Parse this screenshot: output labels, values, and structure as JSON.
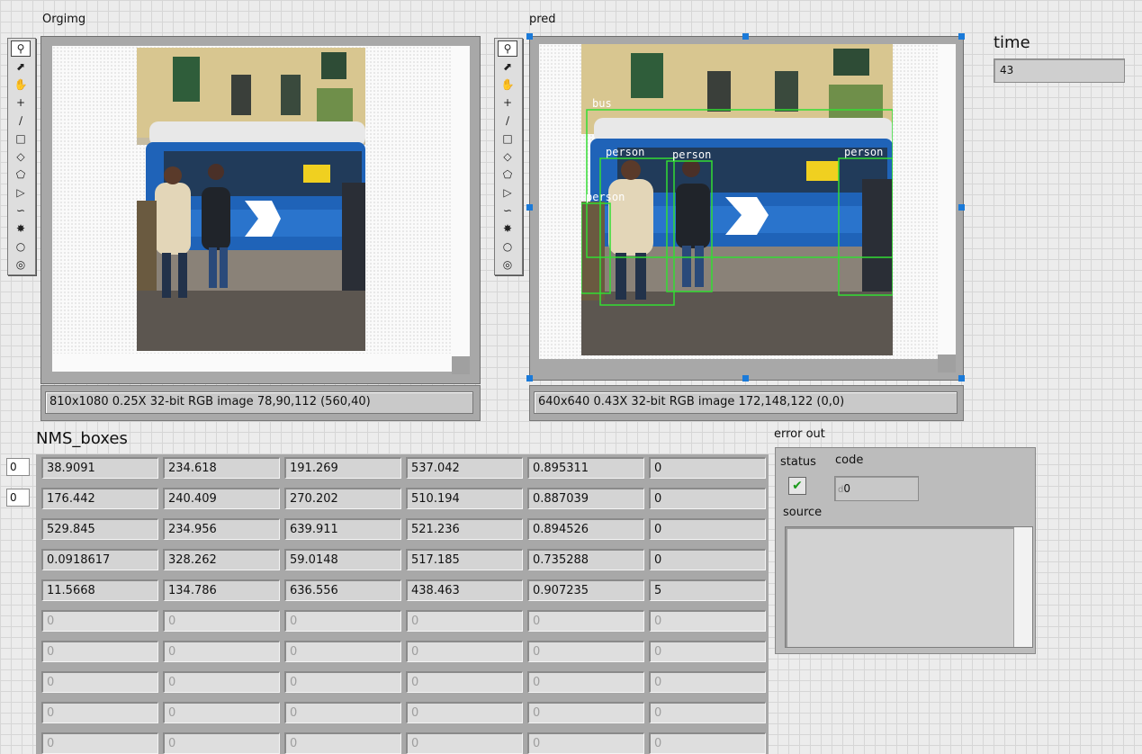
{
  "orgimg": {
    "label": "Orgimg",
    "status": "810x1080 0.25X 32-bit RGB image 78,90,112     (560,40)"
  },
  "pred": {
    "label": "pred",
    "status": "640x640 0.43X 32-bit RGB image 172,148,122     (0,0)",
    "detections": [
      {
        "label": "bus"
      },
      {
        "label": "person"
      },
      {
        "label": "person"
      },
      {
        "label": "person"
      },
      {
        "label": "person"
      }
    ]
  },
  "time": {
    "label": "time",
    "value": "43"
  },
  "nms": {
    "label": "NMS_boxes",
    "row_index": "0",
    "col_index": "0",
    "rows": [
      [
        "38.9091",
        "234.618",
        "191.269",
        "537.042",
        "0.895311",
        "0"
      ],
      [
        "176.442",
        "240.409",
        "270.202",
        "510.194",
        "0.887039",
        "0"
      ],
      [
        "529.845",
        "234.956",
        "639.911",
        "521.236",
        "0.894526",
        "0"
      ],
      [
        "0.0918617",
        "328.262",
        "59.0148",
        "517.185",
        "0.735288",
        "0"
      ],
      [
        "11.5668",
        "134.786",
        "636.556",
        "438.463",
        "0.907235",
        "5"
      ],
      [
        "0",
        "0",
        "0",
        "0",
        "0",
        "0"
      ],
      [
        "0",
        "0",
        "0",
        "0",
        "0",
        "0"
      ],
      [
        "0",
        "0",
        "0",
        "0",
        "0",
        "0"
      ],
      [
        "0",
        "0",
        "0",
        "0",
        "0",
        "0"
      ],
      [
        "0",
        "0",
        "0",
        "0",
        "0",
        "0"
      ]
    ]
  },
  "error_out": {
    "label": "error out",
    "status_label": "status",
    "code_label": "code",
    "code_value": "0",
    "code_prefix": "d",
    "source_label": "source",
    "source_value": "",
    "status_ok": true
  },
  "tools": [
    "zoom-icon",
    "pointer-icon",
    "pan-icon",
    "crosshair-icon",
    "line-icon",
    "rectangle-icon",
    "rotated-rectangle-icon",
    "polygon-icon",
    "broken-line-icon",
    "freehand-icon",
    "freehand-region-icon",
    "oval-icon",
    "annulus-icon"
  ],
  "colors": {
    "detection_box": "#33dd33",
    "selection_handle": "#1a7ad9",
    "status_ok": "#1b9a1b"
  }
}
